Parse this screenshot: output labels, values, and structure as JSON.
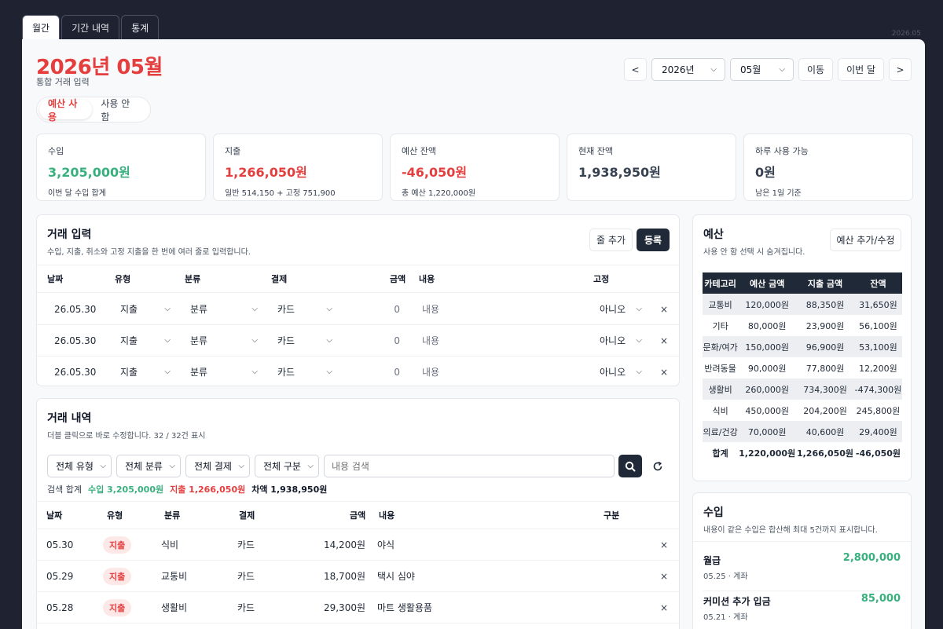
{
  "tabs": [
    "월간",
    "기간 내역",
    "통계"
  ],
  "watermark": "2026.05",
  "header": {
    "title": "2026년 05월",
    "subtitle": "통합 거래 입력",
    "prev": "<",
    "year": "2026년",
    "month": "05월",
    "go": "이동",
    "this_month": "이번 달",
    "next": ">"
  },
  "budget_toggle": {
    "on": "예산 사용",
    "off": "사용 안 함"
  },
  "cards": [
    {
      "label": "수입",
      "value": "3,205,000원",
      "note": "이번 달 수입 합계",
      "color": "#38b07e"
    },
    {
      "label": "지출",
      "value": "1,266,050원",
      "note": "일반 514,150 + 고정 751,900",
      "color": "#e53e3e"
    },
    {
      "label": "예산 잔액",
      "value": "-46,050원",
      "note": "총 예산 1,220,000원",
      "color": "#e53e3e"
    },
    {
      "label": "현재 잔액",
      "value": "1,938,950원",
      "note": "",
      "color": "#374151"
    },
    {
      "label": "하루 사용 가능",
      "value": "0원",
      "note": "남은 1일 기준",
      "color": "#374151"
    }
  ],
  "entry": {
    "title": "거래 입력",
    "desc": "수입, 지출, 취소와 고정 지출을 한 번에 여러 줄로 입력합니다.",
    "add_row": "줄 추가",
    "register": "등록",
    "headers": {
      "date": "날짜",
      "type": "유형",
      "category": "분류",
      "payment": "결제",
      "amount": "금액",
      "memo": "내용",
      "fixed": "고정"
    },
    "rows": [
      {
        "date": "26.05.30",
        "type": "지출",
        "category": "분류",
        "payment": "카드",
        "amount": "0",
        "memo": "내용",
        "fixed": "아니오"
      },
      {
        "date": "26.05.30",
        "type": "지출",
        "category": "분류",
        "payment": "카드",
        "amount": "0",
        "memo": "내용",
        "fixed": "아니오"
      },
      {
        "date": "26.05.30",
        "type": "지출",
        "category": "분류",
        "payment": "카드",
        "amount": "0",
        "memo": "내용",
        "fixed": "아니오"
      }
    ]
  },
  "history": {
    "title": "거래 내역",
    "desc": "더블 클릭으로 바로 수정합니다. 32 / 32건 표시",
    "filters": [
      "전체 유형",
      "전체 분류",
      "전체 결제",
      "전체 구분"
    ],
    "search_placeholder": "내용 검색",
    "summary": {
      "label": "검색 합계",
      "income": "수입 3,205,000원",
      "expense": "지출 1,266,050원",
      "diff": "차액 1,938,950원"
    },
    "headers": {
      "date": "날짜",
      "type": "유형",
      "category": "분류",
      "payment": "결제",
      "amount": "금액",
      "memo": "내용",
      "kind": "구분"
    },
    "rows": [
      {
        "date": "05.30",
        "type": "지출",
        "category": "식비",
        "payment": "카드",
        "amount": "14,200원",
        "memo": "야식"
      },
      {
        "date": "05.29",
        "type": "지출",
        "category": "교통비",
        "payment": "카드",
        "amount": "18,700원",
        "memo": "택시 심야"
      },
      {
        "date": "05.28",
        "type": "지출",
        "category": "생활비",
        "payment": "카드",
        "amount": "29,300원",
        "memo": "마트 생활용품"
      }
    ]
  },
  "budget": {
    "title": "예산",
    "desc": "사용 안 함 선택 시 숨겨집니다.",
    "edit": "예산 추가/수정",
    "headers": [
      "카테고리",
      "예산 금액",
      "지출 금액",
      "잔액"
    ],
    "rows": [
      {
        "cat": "교통비",
        "budget": "120,000원",
        "spent": "88,350원",
        "left": "31,650원",
        "neg": false
      },
      {
        "cat": "기타",
        "budget": "80,000원",
        "spent": "23,900원",
        "left": "56,100원",
        "neg": false
      },
      {
        "cat": "문화/여가",
        "budget": "150,000원",
        "spent": "96,900원",
        "left": "53,100원",
        "neg": false
      },
      {
        "cat": "반려동물",
        "budget": "90,000원",
        "spent": "77,800원",
        "left": "12,200원",
        "neg": false
      },
      {
        "cat": "생활비",
        "budget": "260,000원",
        "spent": "734,300원",
        "left": "-474,300원",
        "neg": true
      },
      {
        "cat": "식비",
        "budget": "450,000원",
        "spent": "204,200원",
        "left": "245,800원",
        "neg": false
      },
      {
        "cat": "의료/건강",
        "budget": "70,000원",
        "spent": "40,600원",
        "left": "29,400원",
        "neg": false
      }
    ],
    "total": {
      "cat": "합계",
      "budget": "1,220,000원",
      "spent": "1,266,050원",
      "left": "-46,050원"
    }
  },
  "income": {
    "title": "수입",
    "desc": "내용이 같은 수입은 합산해 최대 5건까지 표시합니다.",
    "items": [
      {
        "name": "월급",
        "sub": "05.25 · 계좌",
        "amount": "2,800,000"
      },
      {
        "name": "커미션 추가 입금",
        "sub": "05.21 · 계좌",
        "amount": "85,000"
      }
    ]
  },
  "icons": {
    "search": "search-icon",
    "reset": "refresh-icon",
    "chevron": "chevron-down-icon",
    "close": "close-icon"
  }
}
